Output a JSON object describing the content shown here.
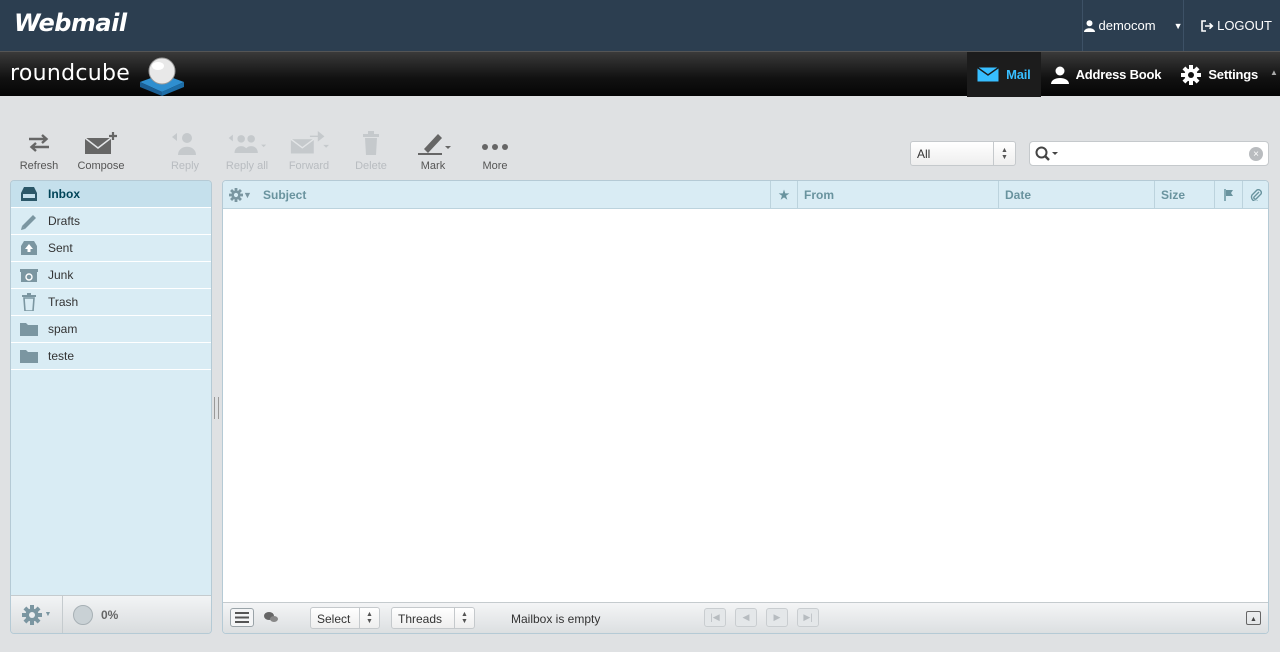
{
  "header": {
    "brand": "Webmail",
    "username": "democom",
    "logout_label": "LOGOUT"
  },
  "app": {
    "logo_text": "roundcube"
  },
  "nav": {
    "mail": "Mail",
    "address_book": "Address Book",
    "settings": "Settings"
  },
  "toolbar": {
    "refresh": "Refresh",
    "compose": "Compose",
    "reply": "Reply",
    "reply_all": "Reply all",
    "forward": "Forward",
    "delete": "Delete",
    "mark": "Mark",
    "more": "More"
  },
  "search": {
    "filter_value": "All"
  },
  "folders": [
    {
      "name": "Inbox",
      "icon": "inbox-icon",
      "selected": true
    },
    {
      "name": "Drafts",
      "icon": "pencil-icon"
    },
    {
      "name": "Sent",
      "icon": "sent-icon"
    },
    {
      "name": "Junk",
      "icon": "junk-icon"
    },
    {
      "name": "Trash",
      "icon": "trash-icon"
    },
    {
      "name": "spam",
      "icon": "folder-icon"
    },
    {
      "name": "teste",
      "icon": "folder-icon"
    }
  ],
  "quota": {
    "value": "0%"
  },
  "columns": {
    "subject": "Subject",
    "from": "From",
    "date": "Date",
    "size": "Size"
  },
  "footer": {
    "select_label": "Select",
    "threads_label": "Threads",
    "status": "Mailbox is empty"
  },
  "colors": {
    "topbar": "#2c3e50",
    "accent": "#37beff",
    "panel": "#d9ecf4"
  }
}
